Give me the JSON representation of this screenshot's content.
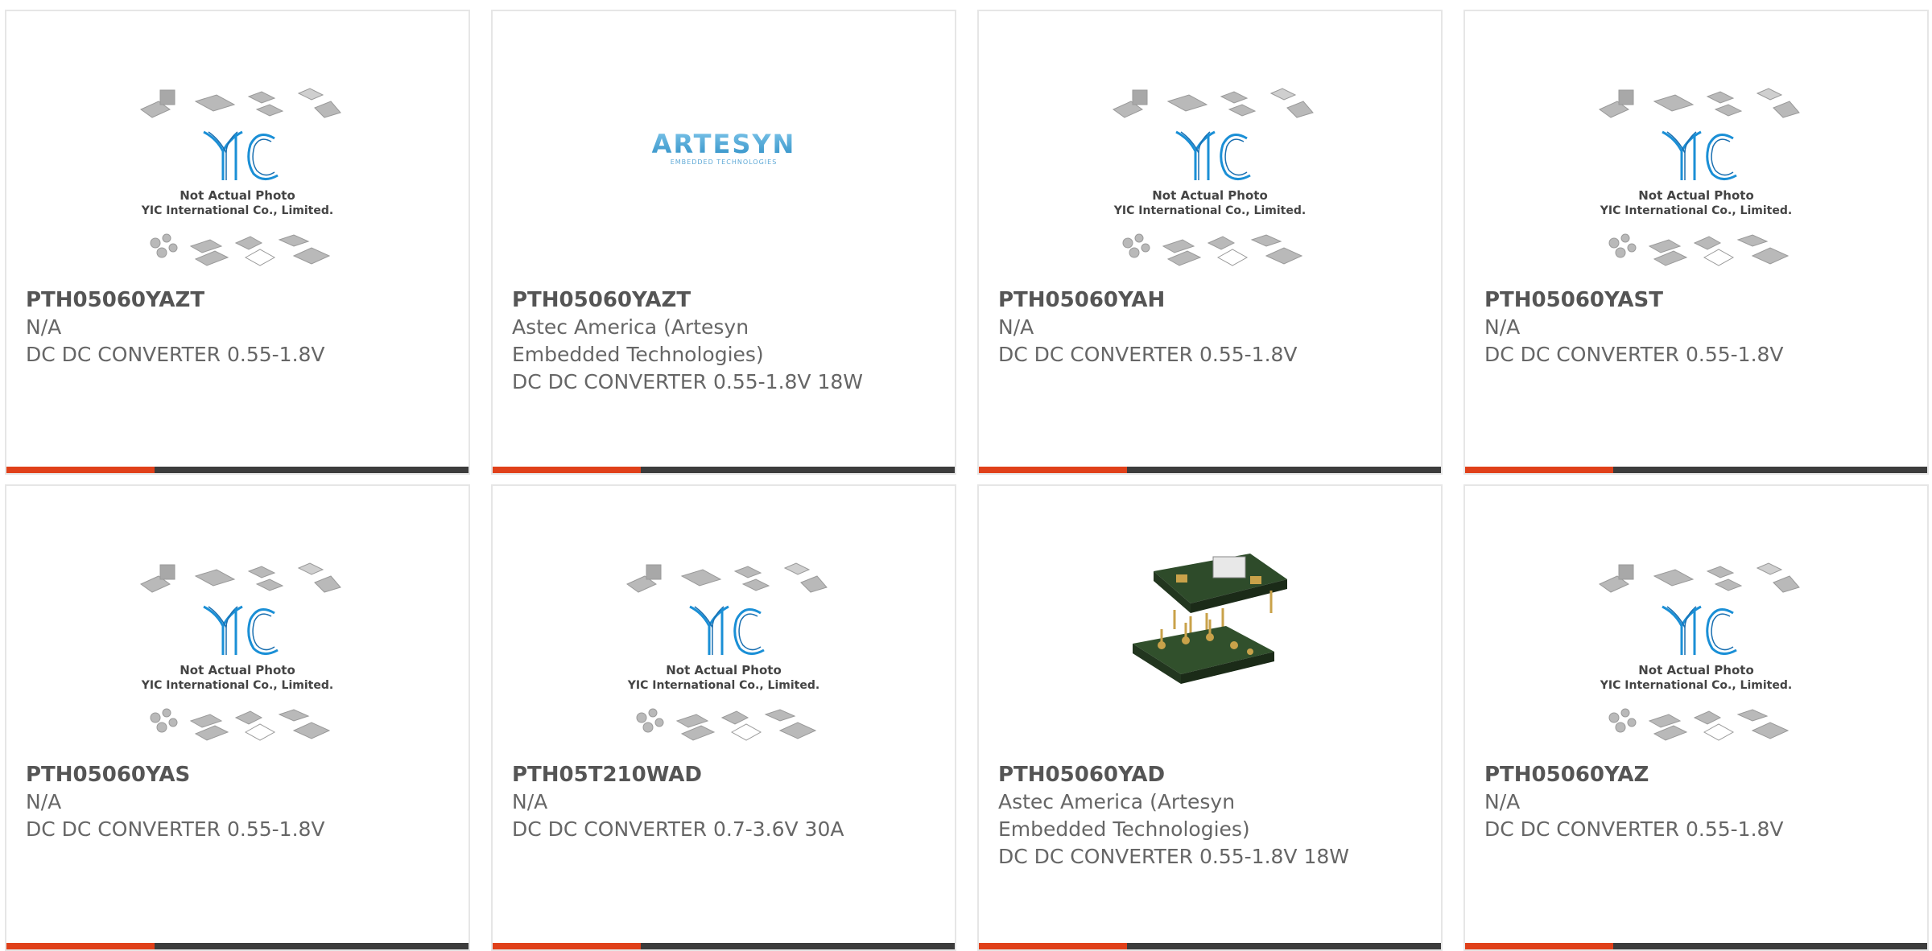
{
  "products": [
    {
      "part_number": "PTH05060YAZT",
      "manufacturer": "N/A",
      "description": "DC DC CONVERTER 0.55-1.8V",
      "image": "yic-placeholder",
      "placeholder_text": [
        "Not Actual Photo",
        "YIC International Co., Limited."
      ],
      "logo_text": "YIC"
    },
    {
      "part_number": "PTH05060YAZT",
      "manufacturer": "Astec America (Artesyn Embedded Technologies)",
      "description": "DC DC CONVERTER 0.55-1.8V 18W",
      "image": "artesyn-logo",
      "logo_text": "ARTESYN",
      "logo_subtext": "EMBEDDED TECHNOLOGIES"
    },
    {
      "part_number": "PTH05060YAH",
      "manufacturer": "N/A",
      "description": "DC DC CONVERTER 0.55-1.8V",
      "image": "yic-placeholder",
      "placeholder_text": [
        "Not Actual Photo",
        "YIC International Co., Limited."
      ],
      "logo_text": "YIC"
    },
    {
      "part_number": "PTH05060YAST",
      "manufacturer": "N/A",
      "description": "DC DC CONVERTER 0.55-1.8V",
      "image": "yic-placeholder",
      "placeholder_text": [
        "Not Actual Photo",
        "YIC International Co., Limited."
      ],
      "logo_text": "YIC"
    },
    {
      "part_number": "PTH05060YAS",
      "manufacturer": "N/A",
      "description": "DC DC CONVERTER 0.55-1.8V",
      "image": "yic-placeholder",
      "placeholder_text": [
        "Not Actual Photo",
        "YIC International Co., Limited."
      ],
      "logo_text": "YIC"
    },
    {
      "part_number": "PTH05T210WAD",
      "manufacturer": "N/A",
      "description": "DC DC CONVERTER 0.7-3.6V 30A",
      "image": "yic-placeholder",
      "placeholder_text": [
        "Not Actual Photo",
        "YIC International Co., Limited."
      ],
      "logo_text": "YIC"
    },
    {
      "part_number": "PTH05060YAD",
      "manufacturer": "Astec America (Artesyn Embedded Technologies)",
      "description": "DC DC CONVERTER 0.55-1.8V 18W",
      "image": "product-photo"
    },
    {
      "part_number": "PTH05060YAZ",
      "manufacturer": "N/A",
      "description": "DC DC CONVERTER 0.55-1.8V",
      "image": "yic-placeholder",
      "placeholder_text": [
        "Not Actual Photo",
        "YIC International Co., Limited."
      ],
      "logo_text": "YIC"
    }
  ],
  "colors": {
    "accent": "#e0401a",
    "bar": "#3c3c3c",
    "logo_blue": "#1a8fd6",
    "text": "#555555"
  }
}
